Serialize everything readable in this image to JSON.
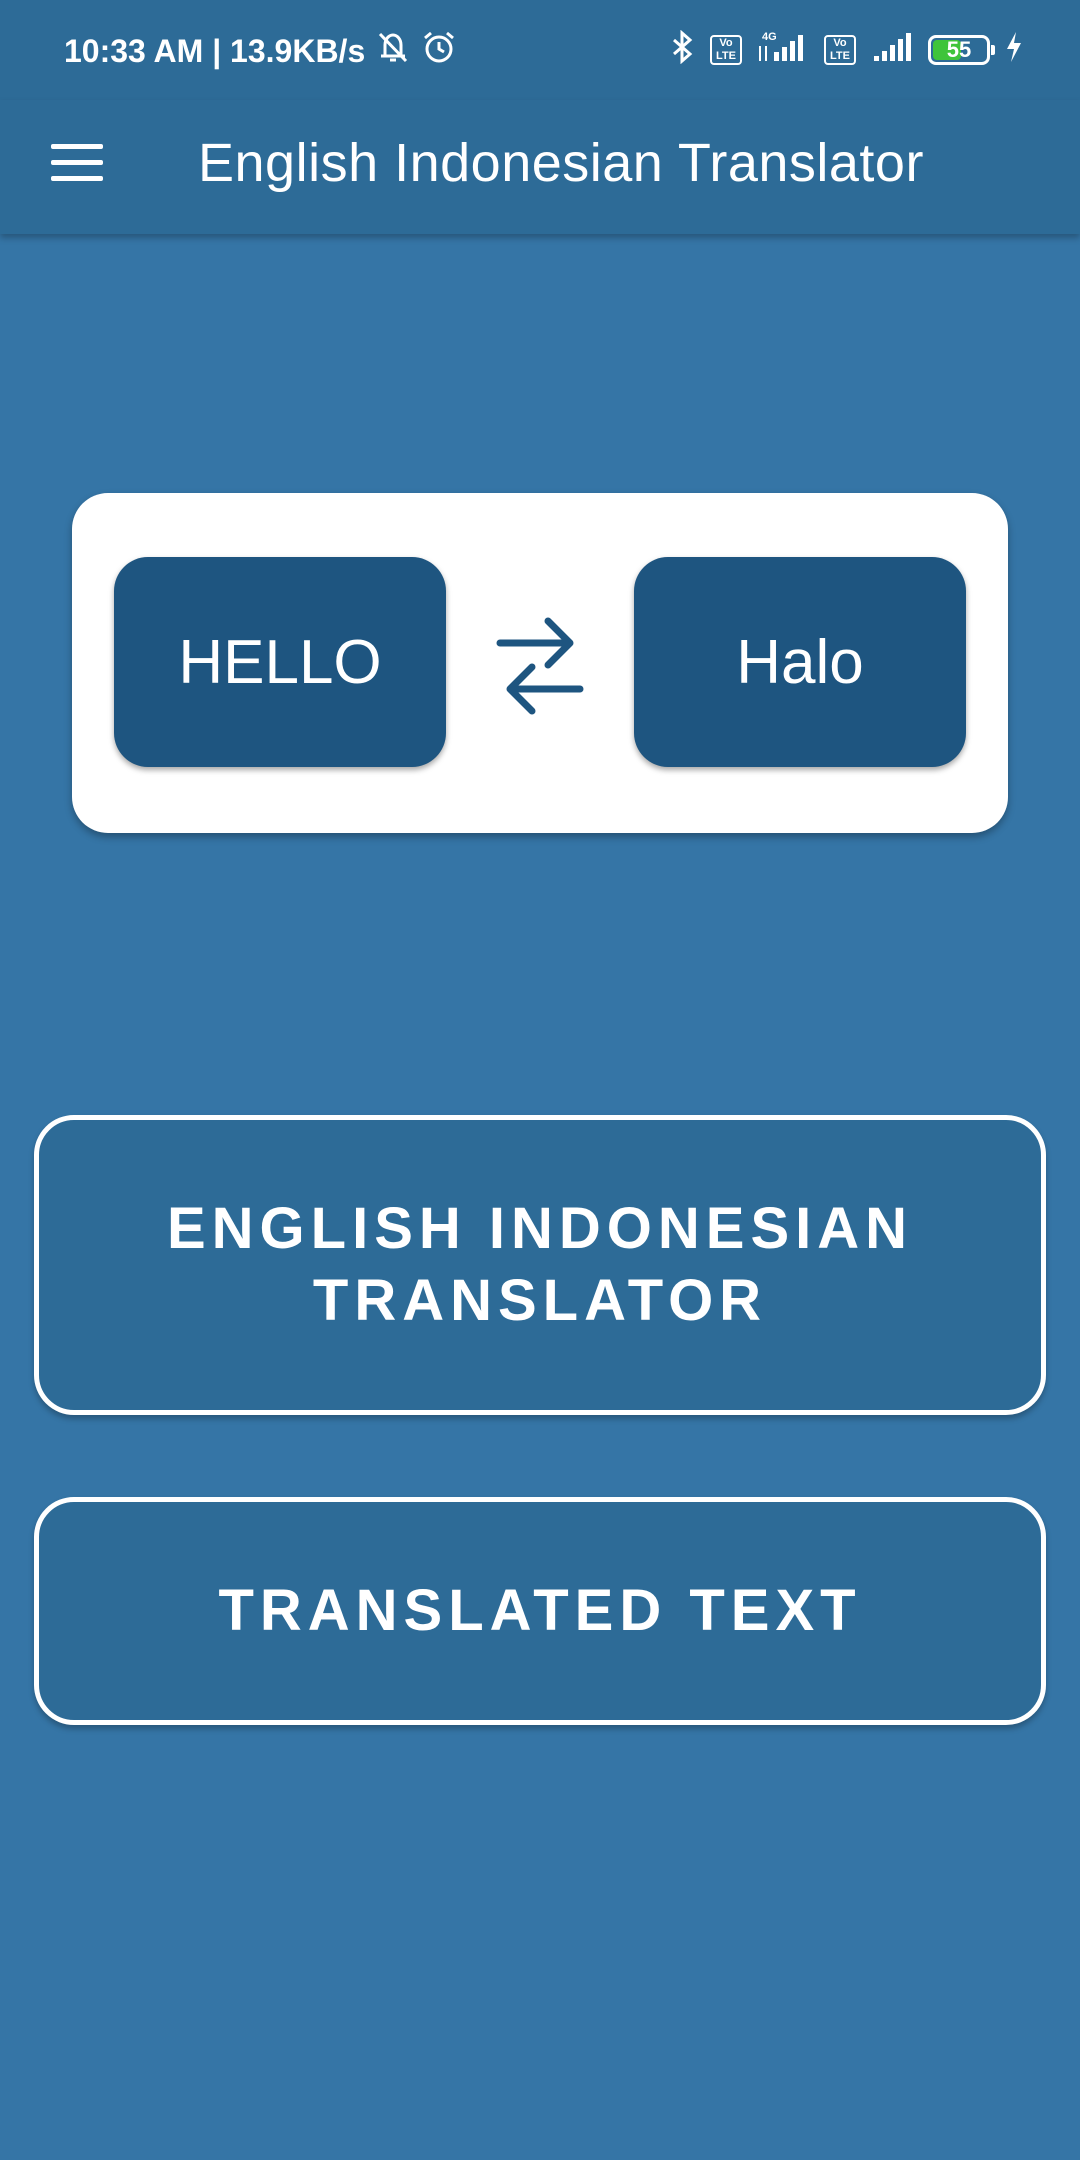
{
  "status_bar": {
    "time": "10:33 AM",
    "net_speed": "13.9KB/s",
    "network": "4G",
    "volte_label_1": "Vo\nLTE",
    "volte_label_2": "Vo\nLTE",
    "battery_level": "55",
    "battery_fraction": 0.55,
    "battery_color": "#3fc43a"
  },
  "app_bar": {
    "title": "English Indonesian Translator",
    "menu_icon": "hamburger-menu-icon"
  },
  "hero": {
    "source_word": "HELLO",
    "target_word": "Halo",
    "swap_icon": "swap-arrows-icon"
  },
  "buttons": {
    "translator_label": "ENGLISH INDONESIAN TRANSLATOR",
    "translated_label": "TRANSLATED TEXT"
  },
  "colors": {
    "background": "#3575a6",
    "bar": "#2d6b97",
    "tile": "#1e5580",
    "card": "#ffffff"
  }
}
